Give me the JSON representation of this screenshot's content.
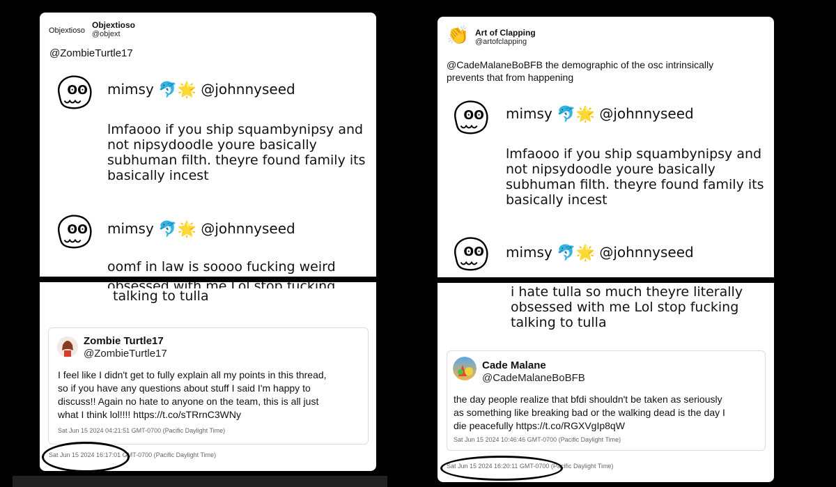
{
  "left": {
    "avatar_label": "Objextioso",
    "name": "Objextioso",
    "handle": "@objext",
    "reply_to": "@ZombieTurtle17",
    "posts": [
      {
        "user": "mimsy",
        "handle": "@johnnyseed",
        "text_lines": [
          "lmfaooo if you ship squambynipsy and",
          "not nipsydoodle youre basically",
          "subhuman filth. theyre found family its",
          "basically incest"
        ]
      },
      {
        "user": "mimsy",
        "handle": "@johnnyseed",
        "text_lines": [
          "oomf in law is soooo fucking weird",
          "obsessed with me Lol stop fucking",
          "talking to tulla"
        ]
      }
    ],
    "quote": {
      "name": "Zombie Turtle17",
      "handle": "@ZombieTurtle17",
      "text_lines": [
        "I feel like I didn't get to fully explain all my points in this thread,",
        "so if you have any questions about stuff I said I'm happy to",
        "discuss!! Again no hate to anyone on the team, this is all just",
        "what I think lol!!!! https://t.co/sTRrnC3WNy"
      ],
      "timestamp": "Sat Jun 15 2024 04:21:51 GMT-0700 (Pacific Daylight Time)"
    },
    "timestamp": "Sat Jun 15 2024 16:17:01 GMT-0700 (Pacific Daylight Time)"
  },
  "right": {
    "name": "Art of Clapping",
    "handle": "@artofclapping",
    "text_lines": [
      "@CadeMalaneBoBFB the demographic of the osc intrinsically",
      "prevents that from happening"
    ],
    "posts": [
      {
        "user": "mimsy",
        "handle": "@johnnyseed",
        "text_lines": [
          "lmfaooo if you ship squambynipsy and",
          "not nipsydoodle youre basically",
          "subhuman filth. theyre found family its",
          "basically incest"
        ]
      },
      {
        "user": "mimsy",
        "handle": "@johnnyseed",
        "text_lines": [
          "i hate tulla so much theyre literally",
          "obsessed with me Lol stop fucking",
          "talking to tulla"
        ]
      }
    ],
    "quote": {
      "name": "Cade Malane",
      "handle": "@CadeMalaneBoBFB",
      "text_lines": [
        "the day people realize that bfdi shouldn't be taken as seriously",
        "as something like breaking bad or the walking dead is the day I",
        "die peacefully https://t.co/RGXVgIp8qW"
      ],
      "timestamp": "Sat Jun 15 2024 10:46:46 GMT-0700 (Pacific Daylight Time)"
    },
    "timestamp": "Sat Jun 15 2024 16:20:11 GMT-0700 (Pacific Daylight Time)"
  },
  "icons": {
    "clap": "👏",
    "dolphin": "🐬",
    "sparkle": "🌟"
  }
}
